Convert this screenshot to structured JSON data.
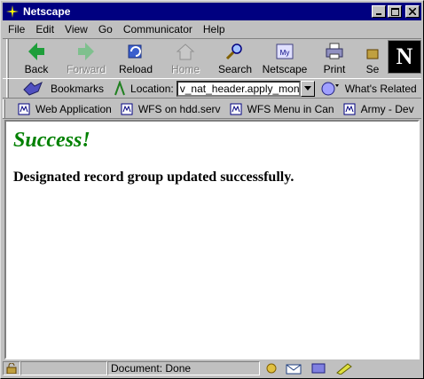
{
  "window": {
    "title": "Netscape"
  },
  "menu": [
    "File",
    "Edit",
    "View",
    "Go",
    "Communicator",
    "Help"
  ],
  "toolbar": {
    "buttons": [
      {
        "label": "Back",
        "icon": "back-arrow-icon",
        "enabled": true
      },
      {
        "label": "Forward",
        "icon": "forward-arrow-icon",
        "enabled": false
      },
      {
        "label": "Reload",
        "icon": "reload-icon",
        "enabled": true
      },
      {
        "label": "Home",
        "icon": "home-icon",
        "enabled": false
      },
      {
        "label": "Search",
        "icon": "search-icon",
        "enabled": true
      },
      {
        "label": "Netscape",
        "icon": "netscape-icon",
        "enabled": true
      },
      {
        "label": "Print",
        "icon": "printer-icon",
        "enabled": true
      },
      {
        "label": "Se",
        "icon": "security-icon",
        "enabled": true
      }
    ],
    "logo_letter": "N"
  },
  "location": {
    "bookmarks_label": "Bookmarks",
    "location_label": "Location:",
    "url": "v_nat_header.apply_monitor",
    "whats_related_label": "What's Related"
  },
  "personal_toolbar": [
    {
      "label": "Web Application"
    },
    {
      "label": "WFS on hdd.serv"
    },
    {
      "label": "WFS Menu in Can"
    },
    {
      "label": "Army - Dev"
    }
  ],
  "content": {
    "heading": "Success!",
    "message": "Designated record group updated successfully."
  },
  "status": {
    "text": "Document: Done"
  },
  "colors": {
    "title_bar": "#000080",
    "heading": "#008000"
  }
}
